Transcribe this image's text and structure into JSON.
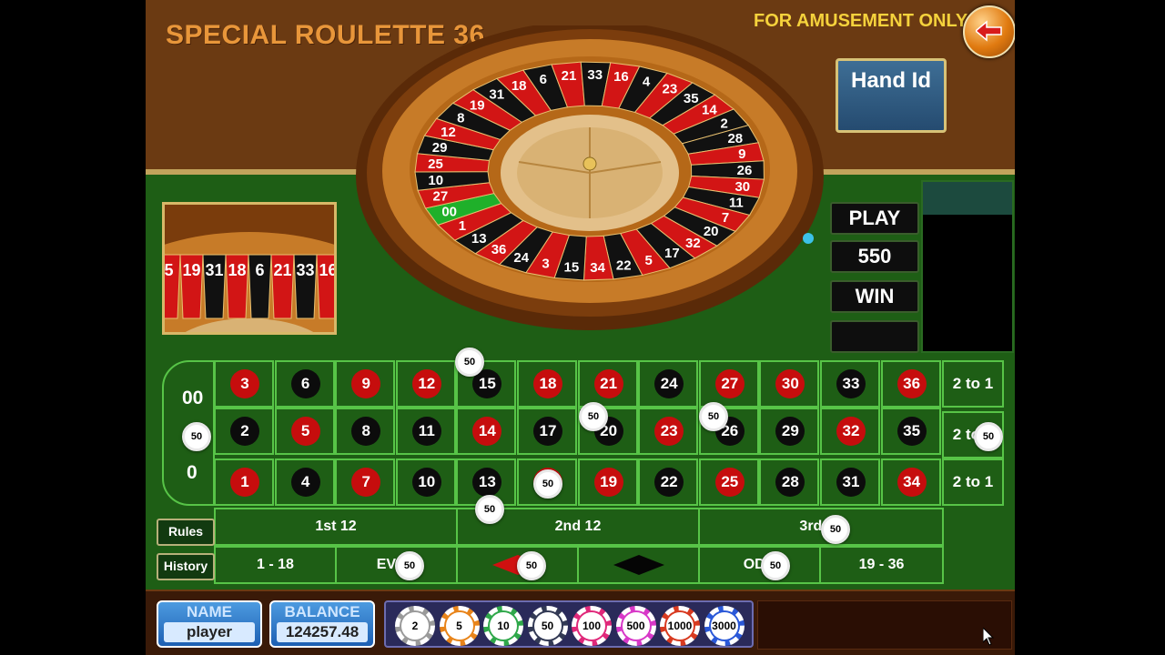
{
  "header": {
    "title": "SPECIAL ROULETTE 36",
    "amusement": "FOR AMUSEMENT ONLY",
    "hand_id": "Hand Id"
  },
  "wheel": {
    "visible_numbers": [
      "19",
      "31",
      "18",
      "6",
      "21",
      "33",
      "16",
      "4",
      "23",
      "35",
      "14",
      "2",
      "28",
      "9",
      "26",
      "30",
      "11",
      "7",
      "20",
      "32",
      "17",
      "5",
      "22",
      "34",
      "15",
      "3",
      "24",
      "36",
      "13",
      "1",
      "00",
      "27",
      "10",
      "25",
      "29",
      "12",
      "8"
    ]
  },
  "mini_wheel": {
    "numbers": [
      "5",
      "19",
      "31",
      "18",
      "6",
      "21",
      "33",
      "16"
    ]
  },
  "side_panel": {
    "play": "PLAY",
    "amount": "550",
    "win": "WIN",
    "empty": ""
  },
  "table": {
    "zeros": [
      "00",
      "0"
    ],
    "rows": [
      [
        {
          "n": "3",
          "c": "red"
        },
        {
          "n": "6",
          "c": "black"
        },
        {
          "n": "9",
          "c": "red"
        },
        {
          "n": "12",
          "c": "red"
        },
        {
          "n": "15",
          "c": "black"
        },
        {
          "n": "18",
          "c": "red"
        },
        {
          "n": "21",
          "c": "red"
        },
        {
          "n": "24",
          "c": "black"
        },
        {
          "n": "27",
          "c": "red"
        },
        {
          "n": "30",
          "c": "red"
        },
        {
          "n": "33",
          "c": "black"
        },
        {
          "n": "36",
          "c": "red"
        }
      ],
      [
        {
          "n": "2",
          "c": "black"
        },
        {
          "n": "5",
          "c": "red"
        },
        {
          "n": "8",
          "c": "black"
        },
        {
          "n": "11",
          "c": "black"
        },
        {
          "n": "14",
          "c": "red"
        },
        {
          "n": "17",
          "c": "black"
        },
        {
          "n": "20",
          "c": "black"
        },
        {
          "n": "23",
          "c": "red"
        },
        {
          "n": "26",
          "c": "black"
        },
        {
          "n": "29",
          "c": "black"
        },
        {
          "n": "32",
          "c": "red"
        },
        {
          "n": "35",
          "c": "black"
        }
      ],
      [
        {
          "n": "1",
          "c": "red"
        },
        {
          "n": "4",
          "c": "black"
        },
        {
          "n": "7",
          "c": "red"
        },
        {
          "n": "10",
          "c": "black"
        },
        {
          "n": "13",
          "c": "black"
        },
        {
          "n": "16",
          "c": "red"
        },
        {
          "n": "19",
          "c": "red"
        },
        {
          "n": "22",
          "c": "black"
        },
        {
          "n": "25",
          "c": "red"
        },
        {
          "n": "28",
          "c": "black"
        },
        {
          "n": "31",
          "c": "black"
        },
        {
          "n": "34",
          "c": "red"
        }
      ]
    ],
    "column_bets": [
      "2 to 1",
      "2 to 1",
      "2 to 1"
    ],
    "dozens": [
      "1st 12",
      "2nd 12",
      "3rd 12"
    ],
    "outside": [
      "1 - 18",
      "EVEN",
      "",
      "",
      "ODD",
      "19 - 36"
    ],
    "placed_chip_label": "50"
  },
  "buttons": {
    "rules": "Rules",
    "history": "History"
  },
  "player": {
    "name_label": "NAME",
    "name": "player",
    "balance_label": "BALANCE",
    "balance": "124257.48"
  },
  "chips": [
    {
      "value": "2",
      "color": "#9a9a9a"
    },
    {
      "value": "5",
      "color": "#e8841a"
    },
    {
      "value": "10",
      "color": "#2fa84a"
    },
    {
      "value": "50",
      "color": "#333a55"
    },
    {
      "value": "100",
      "color": "#e0287a"
    },
    {
      "value": "500",
      "color": "#d838c8"
    },
    {
      "value": "1000",
      "color": "#d83a20"
    },
    {
      "value": "3000",
      "color": "#2a58d8"
    }
  ],
  "colors": {
    "felt": "#1e5e15",
    "wood": "#6b3a12",
    "red": "#c60d0d",
    "black": "#0c0c0c",
    "grid_line": "#57c447"
  }
}
